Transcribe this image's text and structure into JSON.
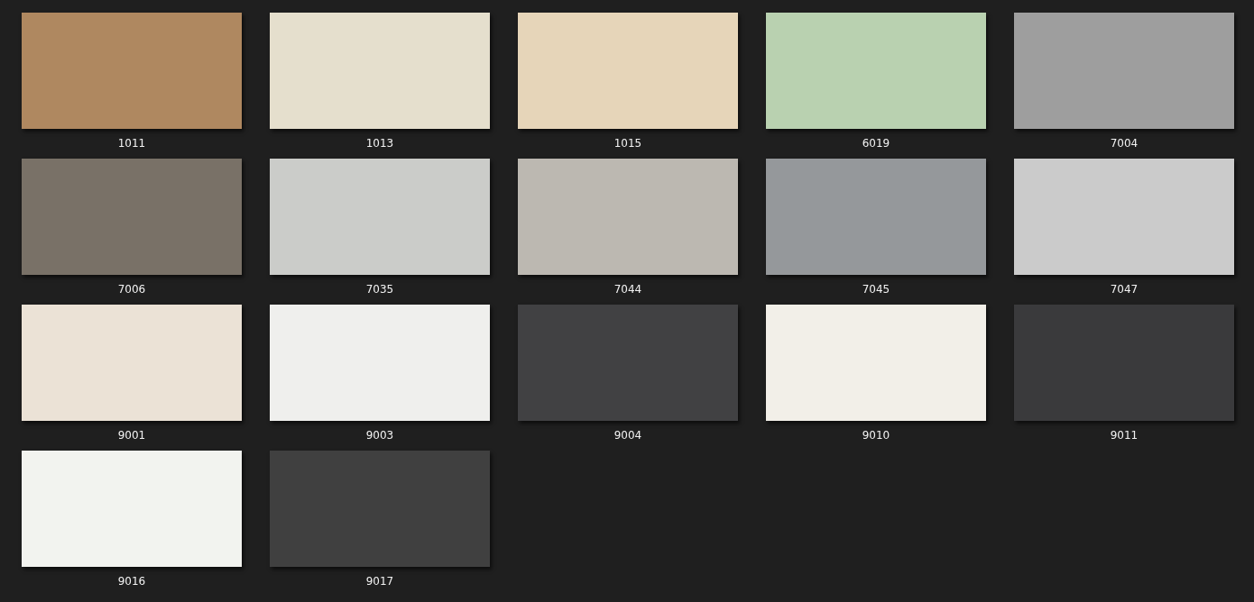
{
  "items": [
    {
      "label": "1011",
      "color": "#af8860"
    },
    {
      "label": "1013",
      "color": "#e5dfcd"
    },
    {
      "label": "1015",
      "color": "#e6d5b9"
    },
    {
      "label": "6019",
      "color": "#b9d1b0"
    },
    {
      "label": "7004",
      "color": "#9e9e9e"
    },
    {
      "label": "7006",
      "color": "#797167"
    },
    {
      "label": "7035",
      "color": "#cbccc9"
    },
    {
      "label": "7044",
      "color": "#bcb8b1"
    },
    {
      "label": "7045",
      "color": "#95989b"
    },
    {
      "label": "7047",
      "color": "#cbcbcb"
    },
    {
      "label": "9001",
      "color": "#ebe2d6"
    },
    {
      "label": "9003",
      "color": "#efefed"
    },
    {
      "label": "9004",
      "color": "#414143"
    },
    {
      "label": "9010",
      "color": "#f2efe8"
    },
    {
      "label": "9011",
      "color": "#3a3a3c"
    },
    {
      "label": "9016",
      "color": "#f2f3ef"
    },
    {
      "label": "9017",
      "color": "#404040"
    }
  ]
}
